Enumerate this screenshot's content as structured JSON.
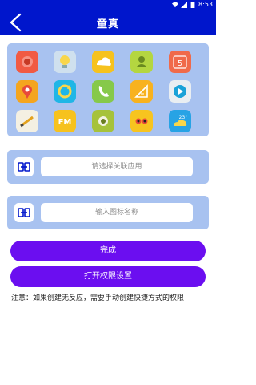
{
  "status_bar": {
    "time": "8:53",
    "icons": [
      "wifi-icon",
      "signal-icon",
      "battery-icon"
    ]
  },
  "app_bar": {
    "title": "童真",
    "back_icon": "chevron-left-icon"
  },
  "icon_grid": {
    "icons": [
      {
        "name": "red-target-app-icon",
        "bg": "#f15a43"
      },
      {
        "name": "bulb-app-icon",
        "bg": "#cfe0ee"
      },
      {
        "name": "cloud-weather-app-icon",
        "bg": "#f6c21e"
      },
      {
        "name": "contact-app-icon",
        "bg": "#b4d640"
      },
      {
        "name": "calendar-5-app-icon",
        "bg": "#f06a4a",
        "text": "5"
      },
      {
        "name": "map-pin-app-icon",
        "bg": "#f4a51f"
      },
      {
        "name": "refresh-app-icon",
        "bg": "#1fb6e6"
      },
      {
        "name": "phone-app-icon",
        "bg": "#86c94a"
      },
      {
        "name": "ruler-app-icon",
        "bg": "#f8b21f"
      },
      {
        "name": "video-play-app-icon",
        "bg": "#e9eef2"
      },
      {
        "name": "pencil-app-icon",
        "bg": "#f4f0e2"
      },
      {
        "name": "fm-radio-app-icon",
        "bg": "#f6c21e",
        "text": "FM"
      },
      {
        "name": "camera-app-icon",
        "bg": "#a6c23a"
      },
      {
        "name": "eyes-app-icon",
        "bg": "#f7c41f"
      },
      {
        "name": "weather-23-app-icon",
        "bg": "#27a3e5",
        "text": "23°"
      }
    ]
  },
  "app_select": {
    "placeholder": "请选择关联应用",
    "icon": "link-icon"
  },
  "icon_name": {
    "placeholder": "输入图标名称",
    "icon": "link-icon"
  },
  "buttons": {
    "done": "完成",
    "permissions": "打开权限设置"
  },
  "note": "注意：如果创建无反应，需要手动创建快捷方式的权限",
  "colors": {
    "primary": "#0016cc",
    "panel": "#a8c2f0",
    "button": "#6b0ef0"
  }
}
